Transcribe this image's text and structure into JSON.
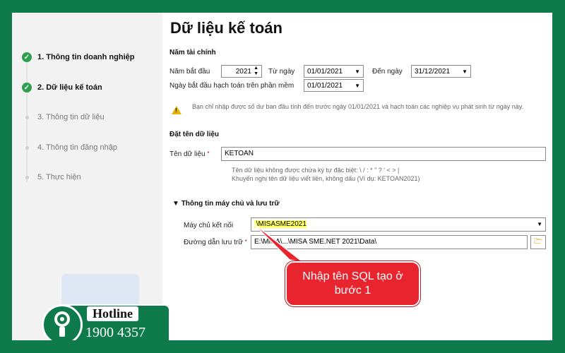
{
  "sidebar": {
    "steps": [
      {
        "label": "1. Thông tin doanh nghiệp",
        "state": "done"
      },
      {
        "label": "2. Dữ liệu kế toán",
        "state": "done"
      },
      {
        "label": "3. Thông tin dữ liệu",
        "state": "pending"
      },
      {
        "label": "4. Thông tin đăng nhập",
        "state": "pending"
      },
      {
        "label": "5. Thực hiện",
        "state": "pending"
      }
    ]
  },
  "main": {
    "title": "Dữ liệu kế toán",
    "fiscal": {
      "section": "Năm tài chính",
      "start_year_label": "Năm bắt đầu",
      "start_year_value": "2021",
      "from_label": "Từ ngày",
      "from_value": "01/01/2021",
      "to_label": "Đến ngày",
      "to_value": "31/12/2021",
      "accounting_start_label": "Ngày bắt đầu hạch toán trên phần mềm",
      "accounting_start_value": "01/01/2021",
      "warning": "Bạn chỉ nhập được số dư ban đầu tính đến trước ngày 01/01/2021 và hạch toán các nghiệp vụ phát sinh từ ngày này."
    },
    "naming": {
      "section": "Đặt tên dữ liệu",
      "name_label": "Tên dữ liệu",
      "name_value": "KETOAN",
      "hint1": "Tên dữ liệu không được chứa ký tự đặc biệt: \\ / : * \" ? ' < > |",
      "hint2": "Khuyến nghị tên dữ liệu viết liền, không dấu (Ví dụ: KETOAN2021)"
    },
    "server": {
      "section": "Thông tin máy chủ và lưu trữ",
      "server_label": "Máy chủ kết nối",
      "server_value": ".\\MISASME2021",
      "path_label": "Đường dẫn lưu trữ",
      "path_value": "E:\\MISA\\...\\MISA SME.NET 2021\\Data\\"
    },
    "callout": "Nhập tên SQL tạo ở bước 1"
  },
  "hotline": {
    "label": "Hotline",
    "number": "1900 4357"
  },
  "colors": {
    "frame": "#0f7a4b",
    "check": "#2e9e4f",
    "callout": "#e8252e",
    "highlight": "#ffff66"
  }
}
